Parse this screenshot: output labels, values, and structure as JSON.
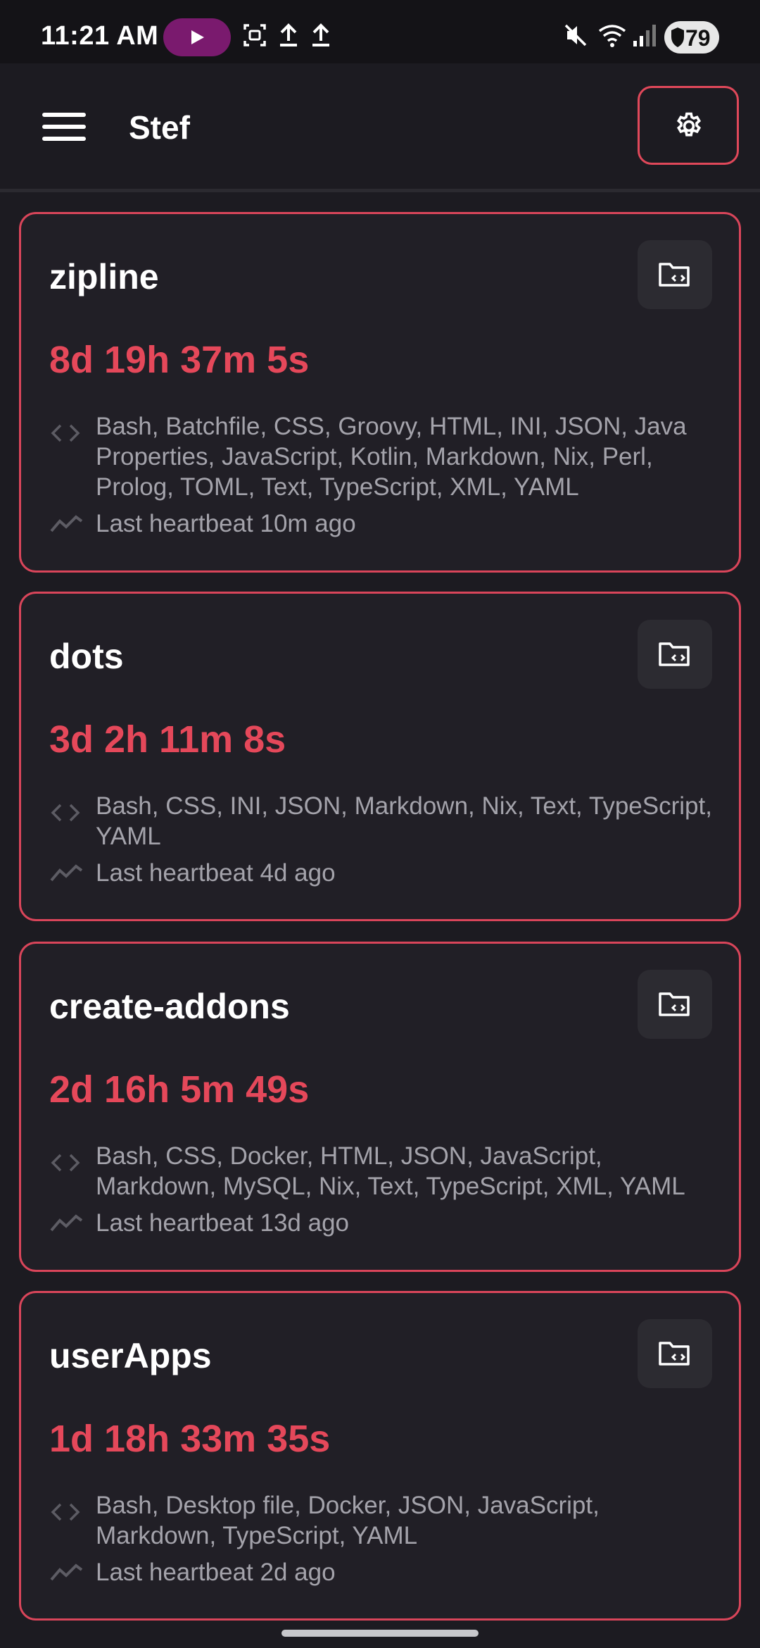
{
  "status_bar": {
    "time": "11:21 AM",
    "battery": "79",
    "icons": [
      "play-icon",
      "screenshot-icon",
      "upload-icon",
      "upload-icon",
      "mute-icon",
      "wifi-icon",
      "signal-icon",
      "battery-icon"
    ]
  },
  "app_bar": {
    "title": "Stef",
    "menu_icon": "menu-icon",
    "settings_icon": "gear-icon"
  },
  "projects": [
    {
      "name": "zipline",
      "time": "8d 19h 37m 5s",
      "languages": "Bash, Batchfile, CSS, Groovy, HTML, INI, JSON, Java Properties, JavaScript, Kotlin, Markdown, Nix, Perl, Prolog, TOML, Text, TypeScript, XML, YAML",
      "heartbeat": "Last heartbeat 10m ago"
    },
    {
      "name": "dots",
      "time": "3d 2h 11m 8s",
      "languages": "Bash, CSS, INI, JSON, Markdown, Nix, Text, TypeScript, YAML",
      "heartbeat": "Last heartbeat 4d ago"
    },
    {
      "name": "create-addons",
      "time": "2d 16h 5m 49s",
      "languages": "Bash, CSS, Docker, HTML, JSON, JavaScript, Markdown, MySQL, Nix, Text, TypeScript, XML, YAML",
      "heartbeat": "Last heartbeat 13d ago"
    },
    {
      "name": "userApps",
      "time": "1d 18h 33m 35s",
      "languages": "Bash, Desktop file, Docker, JSON, JavaScript, Markdown, TypeScript, YAML",
      "heartbeat": "Last heartbeat 2d ago"
    }
  ],
  "colors": {
    "background": "#1c1b21",
    "card_border": "#d9455a",
    "accent": "#e5485a",
    "muted_text": "#a4a3ab"
  }
}
